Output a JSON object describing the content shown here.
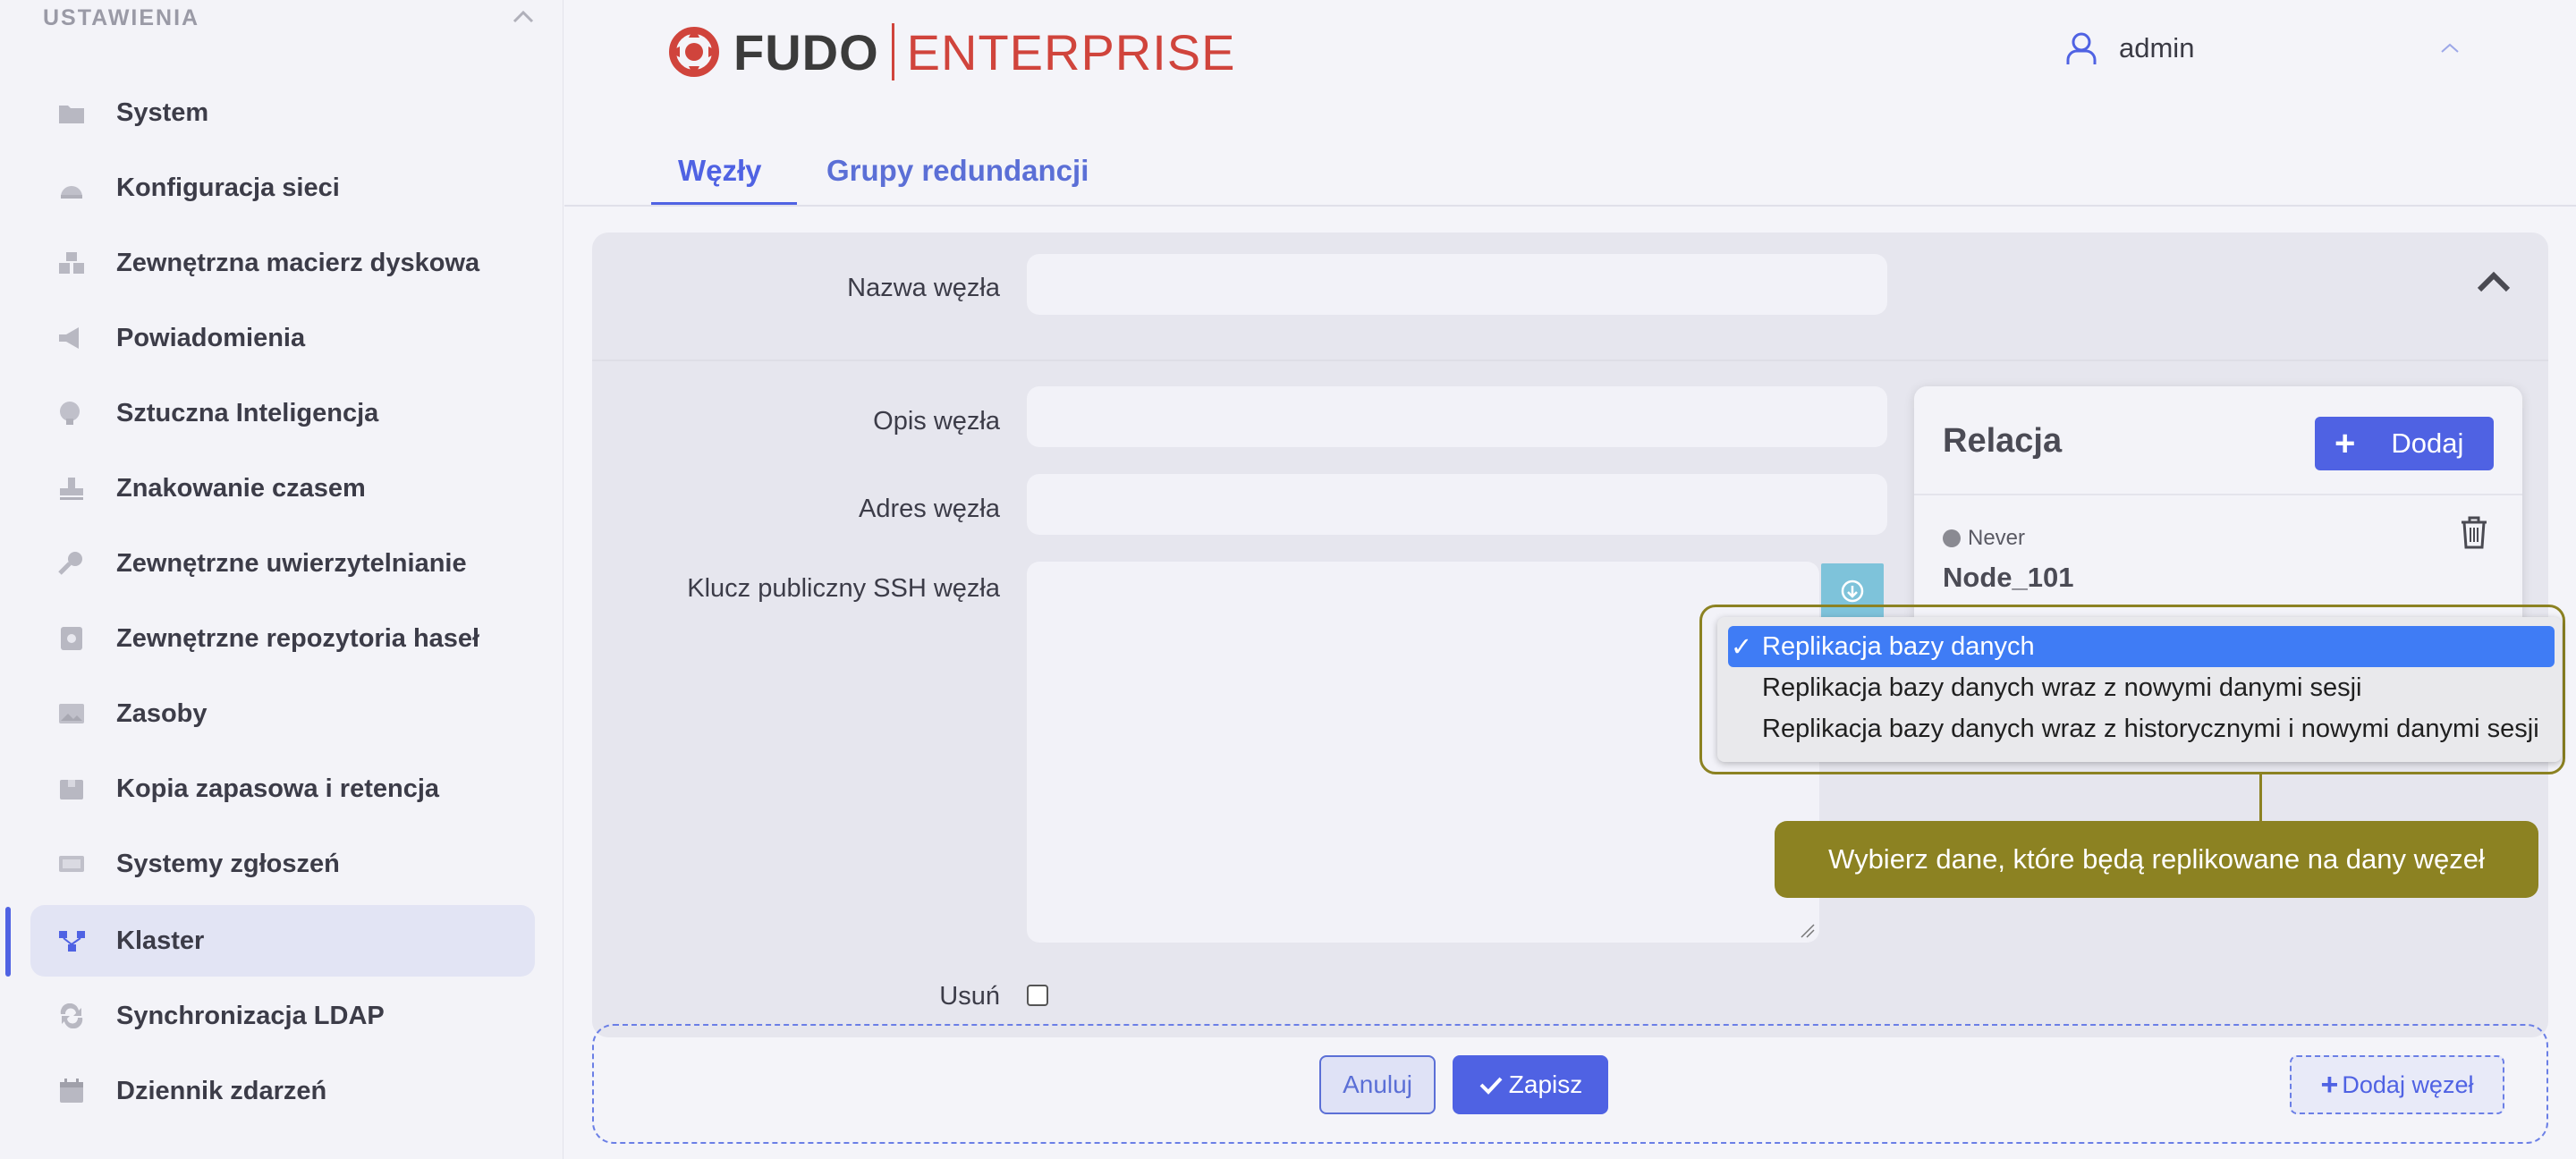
{
  "sidebar": {
    "header": "USTAWIENIA",
    "items": [
      {
        "label": "System",
        "icon": "folder-icon"
      },
      {
        "label": "Konfiguracja sieci",
        "icon": "network-icon"
      },
      {
        "label": "Zewnętrzna macierz dyskowa",
        "icon": "storage-icon"
      },
      {
        "label": "Powiadomienia",
        "icon": "megaphone-icon"
      },
      {
        "label": "Sztuczna Inteligencja",
        "icon": "brain-icon"
      },
      {
        "label": "Znakowanie czasem",
        "icon": "stamp-icon"
      },
      {
        "label": "Zewnętrzne uwierzytelnianie",
        "icon": "key-icon"
      },
      {
        "label": "Zewnętrzne repozytoria haseł",
        "icon": "vault-icon"
      },
      {
        "label": "Zasoby",
        "icon": "image-icon"
      },
      {
        "label": "Kopia zapasowa i retencja",
        "icon": "archive-icon"
      },
      {
        "label": "Systemy zgłoszeń",
        "icon": "ticket-icon"
      },
      {
        "label": "Klaster",
        "icon": "cluster-icon",
        "active": true
      },
      {
        "label": "Synchronizacja LDAP",
        "icon": "sync-icon"
      },
      {
        "label": "Dziennik zdarzeń",
        "icon": "calendar-icon"
      }
    ]
  },
  "header": {
    "logo_left": "FUDO",
    "logo_right": "ENTERPRISE",
    "user": "admin"
  },
  "tabs": [
    "Węzły",
    "Grupy redundancji"
  ],
  "form": {
    "node_name_label": "Nazwa węzła",
    "node_desc_label": "Opis węzła",
    "node_address_label": "Adres węzła",
    "ssh_key_label": "Klucz publiczny SSH węzła",
    "delete_label": "Usuń"
  },
  "relation": {
    "title": "Relacja",
    "add_label": "Dodaj",
    "status": "Never",
    "node": "Node_101"
  },
  "dropdown": {
    "options": [
      "Replikacja bazy danych",
      "Replikacja bazy danych wraz z nowymi danymi sesji",
      "Replikacja bazy danych wraz z historycznymi i nowymi danymi sesji"
    ],
    "selected_index": 0
  },
  "callout": "Wybierz dane, które będą replikowane na dany węzeł",
  "actions": {
    "cancel": "Anuluj",
    "save": "Zapisz",
    "add_node": "Dodaj węzeł"
  },
  "colors": {
    "accent": "#4f62e3",
    "brand_red": "#d0443c",
    "callout": "#8c8222",
    "dropdown_selected": "#3f7cf5"
  }
}
